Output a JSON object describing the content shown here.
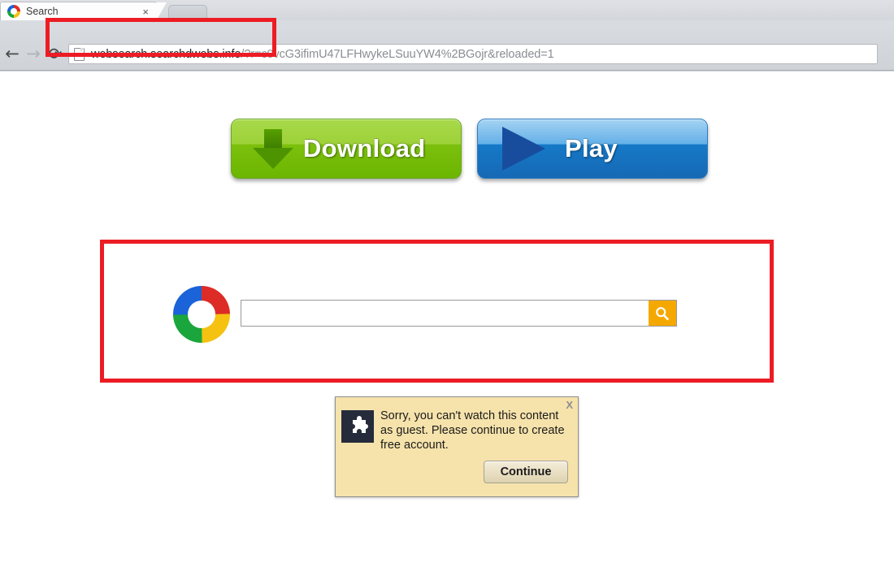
{
  "browser": {
    "tab": {
      "title": "Search",
      "favicon_icon": "multicolor-ring-icon",
      "close_label": "×"
    },
    "new_tab_label": "",
    "nav": {
      "back_icon": "←",
      "forward_icon": "→",
      "reload_icon": "⟳"
    },
    "omnibox": {
      "page_icon": "document-icon",
      "url_host": "websearch.searchdwebs.info",
      "url_rest": "/?r=c0vcG3ifimU47LFHwykeLSuuYW4%2BGojr&reloaded=1",
      "url_full": "websearch.searchdwebs.info/?r=c0vcG3ifimU47LFHwykeLSuuYW4%2BGojr&reloaded=1"
    }
  },
  "annotations": {
    "color": "#ED1C24",
    "urlbar_highlight_label": "url-bar-highlight",
    "searchbox_highlight_label": "search-area-highlight"
  },
  "page": {
    "download_button": {
      "label": "Download",
      "icon": "down-arrow-icon",
      "color": "#7cc00d"
    },
    "play_button": {
      "label": "Play",
      "icon": "play-triangle-icon",
      "color": "#1579c8"
    },
    "search": {
      "logo_icon": "multicolor-ring-icon",
      "input_value": "",
      "input_placeholder": "",
      "submit_icon": "magnifier-icon",
      "submit_color": "#f5a800"
    },
    "popup": {
      "icon": "puzzle-piece-icon",
      "message": "Sorry, you can't watch this content as guest. Please continue to create free account.",
      "close_label": "X",
      "continue_label": "Continue",
      "background_color": "#f6e3ab"
    }
  }
}
